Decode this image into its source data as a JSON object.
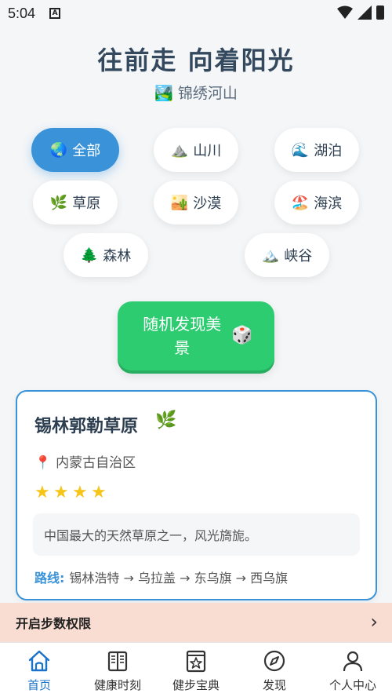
{
  "status_bar": {
    "time": "5:04",
    "notif_glyph": "A"
  },
  "header": {
    "title": "往前走 向着阳光",
    "subtitle_emoji": "🏞️",
    "subtitle": "锦绣河山"
  },
  "categories": [
    {
      "emoji": "🌏",
      "label": "全部",
      "active": true
    },
    {
      "emoji": "⛰️",
      "label": "山川",
      "active": false
    },
    {
      "emoji": "🌊",
      "label": "湖泊",
      "active": false
    },
    {
      "emoji": "🌿",
      "label": "草原",
      "active": false
    },
    {
      "emoji": "🏜️",
      "label": "沙漠",
      "active": false
    },
    {
      "emoji": "🏖️",
      "label": "海滨",
      "active": false
    },
    {
      "emoji": "🌲",
      "label": "森林",
      "active": false
    },
    {
      "emoji": "🏔️",
      "label": "峡谷",
      "active": false
    }
  ],
  "random_button": {
    "label": "随机发现美景",
    "icon": "🎲"
  },
  "card": {
    "title": "锡林郭勒草原",
    "title_icon": "🌿",
    "location_icon": "📍",
    "location": "内蒙古自治区",
    "rating": 4,
    "star_glyph": "★",
    "description": "中国最大的天然草原之一，风光旖旎。",
    "route_label": "路线:",
    "route": "锡林浩特 → 乌拉盖 → 东乌旗 → 西乌旗"
  },
  "permission_banner": {
    "text": "开启步数权限",
    "arrow": "›"
  },
  "tabbar": [
    {
      "label": "首页",
      "icon": "home-icon",
      "active": true
    },
    {
      "label": "健康时刻",
      "icon": "book-icon",
      "active": false
    },
    {
      "label": "健步宝典",
      "icon": "star-book-icon",
      "active": false
    },
    {
      "label": "发现",
      "icon": "compass-icon",
      "active": false
    },
    {
      "label": "个人中心",
      "icon": "person-icon",
      "active": false
    }
  ],
  "colors": {
    "accent": "#3a93d9",
    "green": "#2ecc71",
    "star": "#f5c518",
    "banner": "#f9ddd3"
  }
}
